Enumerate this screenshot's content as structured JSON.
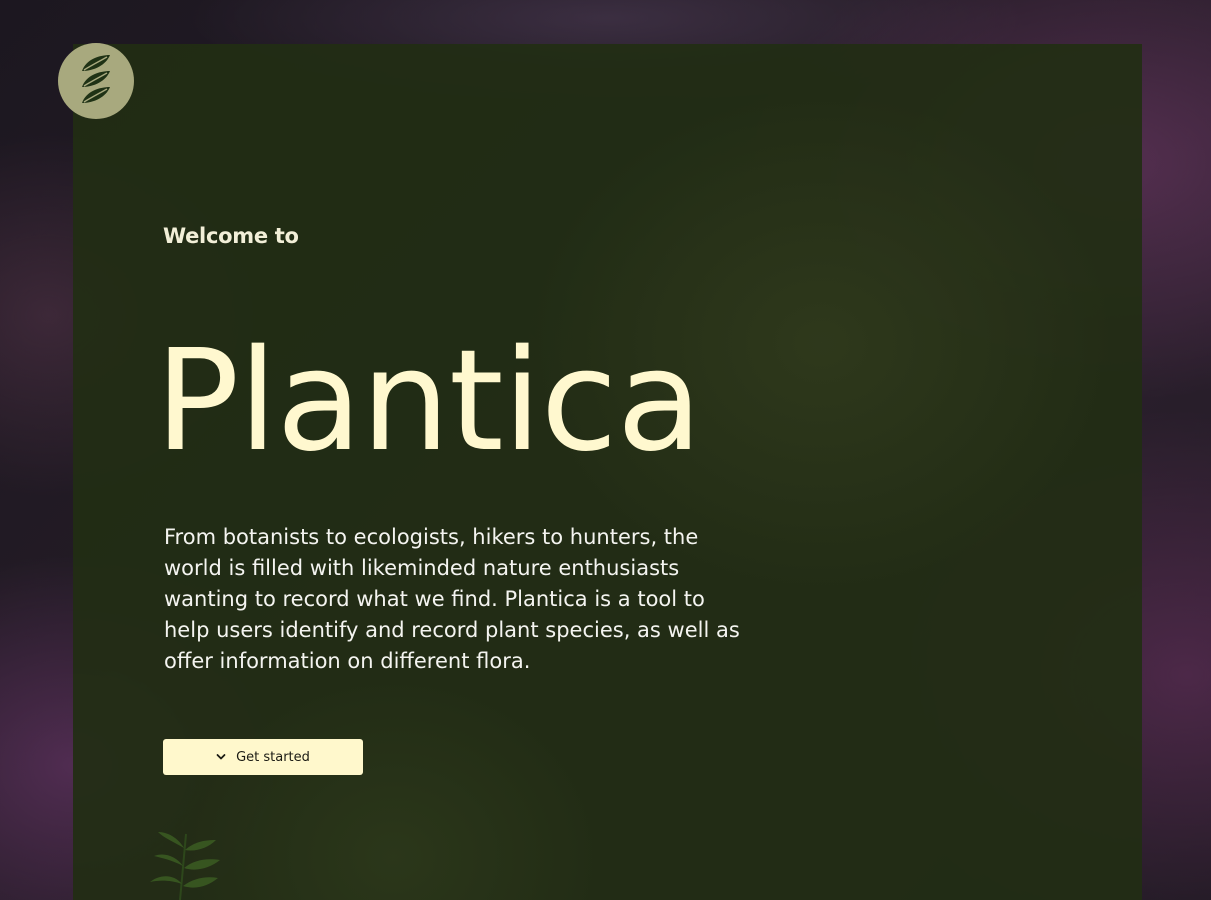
{
  "logo": {
    "icon": "leaf-icon"
  },
  "hero": {
    "welcome": "Welcome to",
    "title": "Plantica",
    "description": "From botanists to ecologists, hikers to hunters, the world is filled with likeminded nature enthusiasts wanting to record what we find. Plantica is a tool to help users identify and record plant species, as well as offer information on different flora.",
    "cta_label": "Get started",
    "cta_icon": "chevron-down-icon",
    "decoration_icon": "fern-icon"
  },
  "colors": {
    "accent": "#fff8cf",
    "panel": "#222e14",
    "logo_bg": "#a8a97e",
    "button_bg": "#fff8cc"
  }
}
